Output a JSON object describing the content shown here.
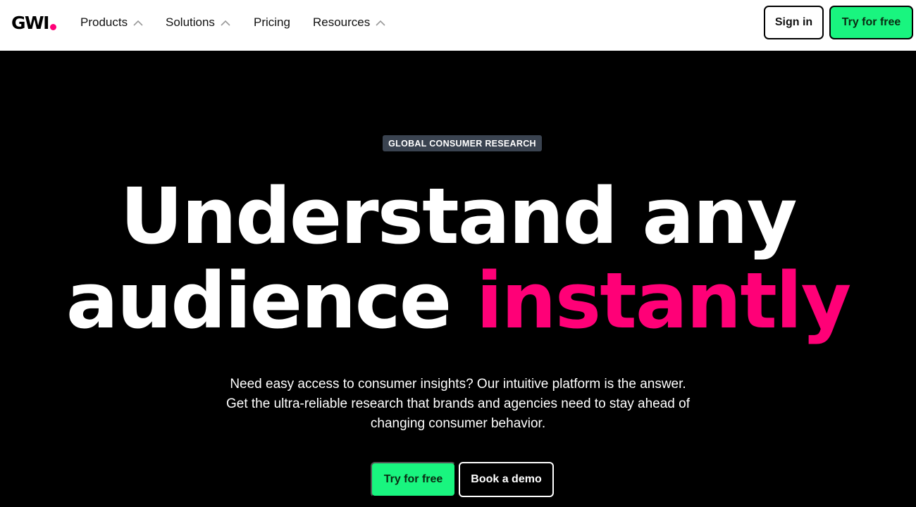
{
  "colors": {
    "brand_pink": "#ff0077",
    "accent_green": "#19f57f",
    "eyebrow_bg": "#3a4350"
  },
  "header": {
    "logo_text": "GWI",
    "nav": [
      {
        "label": "Products",
        "icon": "chevron-up-icon"
      },
      {
        "label": "Solutions",
        "icon": "chevron-up-icon"
      },
      {
        "label": "Pricing"
      },
      {
        "label": "Resources",
        "icon": "chevron-up-icon"
      }
    ],
    "sign_in_label": "Sign in",
    "try_free_label": "Try for free"
  },
  "hero": {
    "eyebrow": "GLOBAL CONSUMER RESEARCH",
    "headline_line1": "Understand any",
    "headline_line2_white": "audience ",
    "headline_line2_accent": "instantly",
    "subtext_lines": [
      "Need easy access to consumer insights? Our intuitive platform is the answer.",
      "Get the ultra-reliable research that brands and agencies need to stay ahead of",
      "changing consumer behavior."
    ],
    "primary_cta": "Try for free",
    "secondary_cta": "Book a demo"
  }
}
